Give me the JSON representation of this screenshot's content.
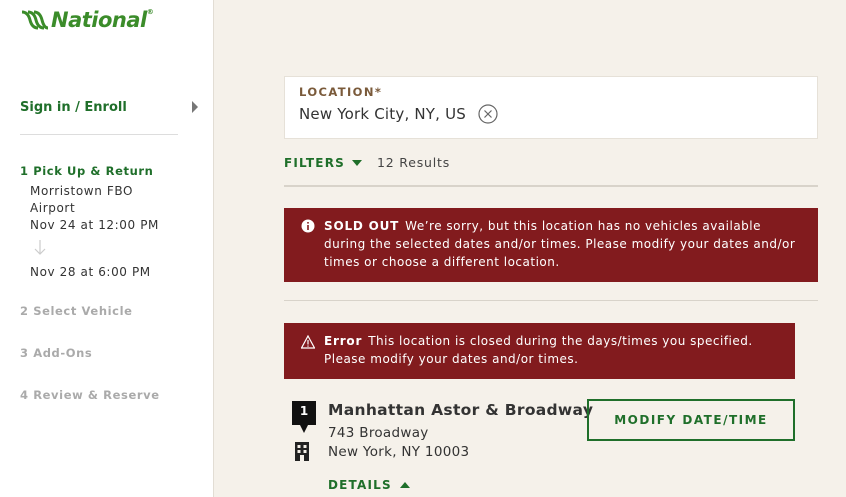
{
  "brand": {
    "name": "National",
    "trademark": "®",
    "color": "#3b8c2a"
  },
  "sidebar": {
    "signin_label": "Sign in / Enroll",
    "steps": [
      {
        "label": "1 Pick Up & Return",
        "active": true
      },
      {
        "label": "2 Select Vehicle",
        "active": false
      },
      {
        "label": "3 Add-Ons",
        "active": false
      },
      {
        "label": "4 Review & Reserve",
        "active": false
      }
    ],
    "pickup": {
      "location_line1": "Morristown FBO",
      "location_line2": "Airport",
      "pickup_datetime": "Nov 24 at 12:00 PM",
      "return_datetime": "Nov 28 at 6:00 PM"
    }
  },
  "search": {
    "location_label": "LOCATION*",
    "location_value": "New York City, NY, US"
  },
  "filters": {
    "label": "FILTERS",
    "results": "12 Results"
  },
  "alerts": {
    "sold_out": {
      "title": "SOLD OUT",
      "message": "We’re sorry, but this location has no vehicles available during the selected dates and/or times. Please modify your dates and/or times or choose a different location."
    },
    "error": {
      "title": "Error",
      "message": "This location is closed during the days/times you specified. Please modify your dates and/or times."
    }
  },
  "result": {
    "number": "1",
    "name": "Manhattan Astor & Broadway",
    "address_line1": "743 Broadway",
    "address_line2": "New York, NY 10003",
    "modify_button": "MODIFY DATE/TIME",
    "details_label": "DETAILS"
  },
  "colors": {
    "accent_green": "#1f6f2a",
    "alert_red": "#821b1e",
    "page_bg": "#f5f1ea"
  }
}
